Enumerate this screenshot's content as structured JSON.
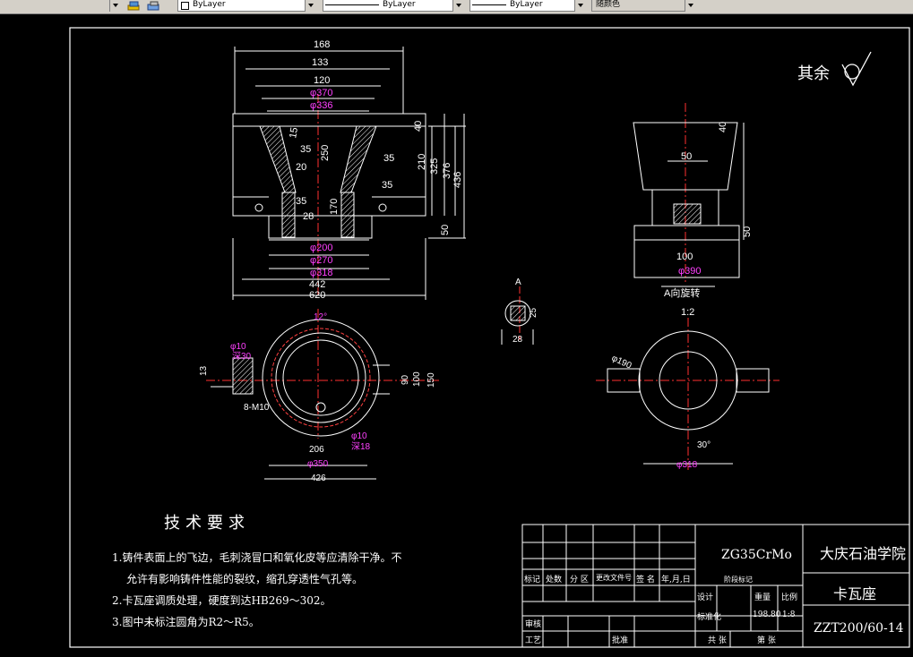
{
  "toolbar": {
    "color_field": "ByLayer",
    "linetype_field": "ByLayer",
    "lineweight_field": "ByLayer",
    "plotstyle_field": "随颜色"
  },
  "drawing": {
    "surface_note": "其余",
    "front_view": {
      "dims": [
        "168",
        "133",
        "120",
        "φ370",
        "φ336",
        "φ200",
        "φ270",
        "φ318",
        "442",
        "620"
      ],
      "heights": [
        "40",
        "210",
        "325",
        "376",
        "436",
        "250",
        "170",
        "50"
      ],
      "angles": [
        "15",
        "35",
        "35",
        "35",
        "20",
        "28",
        "35"
      ]
    },
    "side_view": {
      "label": "A向旋转",
      "scale": "1:2",
      "dims": [
        "40",
        "50",
        "100",
        "φ390",
        "50"
      ]
    },
    "section_view": {
      "labels": [
        "A",
        "28",
        "25"
      ]
    },
    "top_view": {
      "dims": [
        "12°",
        "φ10",
        "深30",
        "13",
        "8-M10",
        "φ10",
        "深18",
        "206",
        "φ350",
        "426",
        "90",
        "100",
        "150"
      ]
    },
    "slot_view": {
      "dims": [
        "φ190",
        "30°",
        "φ318"
      ]
    }
  },
  "tech_requirements": {
    "title": "技术要求",
    "items": [
      "1.铸件表面上的飞边，毛刺浇冒口和氧化皮等应清除干净。不",
      "允许有影响铸件性能的裂纹，缩孔穿透性气孔等。",
      "2.卡瓦座调质处理，硬度到达HB269～302。",
      "3.图中未标注圆角为R2～R5。"
    ]
  },
  "title_block": {
    "material": "ZG35CrMo",
    "school": "大庆石油学院",
    "part_name": "卡瓦座",
    "drawing_no": "ZZT200/60-14",
    "rev_headers": [
      "标记",
      "处数",
      "分 区",
      "更改文件号",
      "签 名",
      "年,月,日"
    ],
    "labels": {
      "design": "设计",
      "standard": "标准化",
      "stage": "阶段标记",
      "weight": "重量",
      "scale": "比例",
      "check": "审核",
      "process": "工艺",
      "approve": "批准",
      "total": "共  张",
      "sheet": "第  张"
    },
    "weight_value": "198.80",
    "scale_value": "1:8"
  }
}
